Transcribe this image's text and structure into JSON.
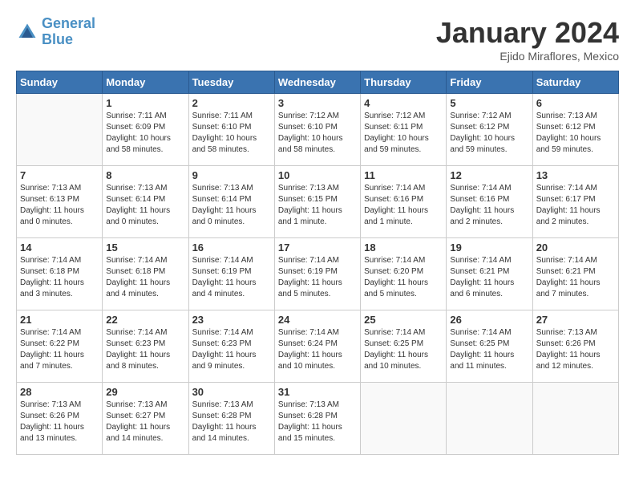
{
  "header": {
    "logo_general": "General",
    "logo_blue": "Blue",
    "month": "January 2024",
    "location": "Ejido Miraflores, Mexico"
  },
  "weekdays": [
    "Sunday",
    "Monday",
    "Tuesday",
    "Wednesday",
    "Thursday",
    "Friday",
    "Saturday"
  ],
  "weeks": [
    [
      {
        "day": "",
        "sunrise": "",
        "sunset": "",
        "daylight": ""
      },
      {
        "day": "1",
        "sunrise": "Sunrise: 7:11 AM",
        "sunset": "Sunset: 6:09 PM",
        "daylight": "Daylight: 10 hours and 58 minutes."
      },
      {
        "day": "2",
        "sunrise": "Sunrise: 7:11 AM",
        "sunset": "Sunset: 6:10 PM",
        "daylight": "Daylight: 10 hours and 58 minutes."
      },
      {
        "day": "3",
        "sunrise": "Sunrise: 7:12 AM",
        "sunset": "Sunset: 6:10 PM",
        "daylight": "Daylight: 10 hours and 58 minutes."
      },
      {
        "day": "4",
        "sunrise": "Sunrise: 7:12 AM",
        "sunset": "Sunset: 6:11 PM",
        "daylight": "Daylight: 10 hours and 59 minutes."
      },
      {
        "day": "5",
        "sunrise": "Sunrise: 7:12 AM",
        "sunset": "Sunset: 6:12 PM",
        "daylight": "Daylight: 10 hours and 59 minutes."
      },
      {
        "day": "6",
        "sunrise": "Sunrise: 7:13 AM",
        "sunset": "Sunset: 6:12 PM",
        "daylight": "Daylight: 10 hours and 59 minutes."
      }
    ],
    [
      {
        "day": "7",
        "sunrise": "Sunrise: 7:13 AM",
        "sunset": "Sunset: 6:13 PM",
        "daylight": "Daylight: 11 hours and 0 minutes."
      },
      {
        "day": "8",
        "sunrise": "Sunrise: 7:13 AM",
        "sunset": "Sunset: 6:14 PM",
        "daylight": "Daylight: 11 hours and 0 minutes."
      },
      {
        "day": "9",
        "sunrise": "Sunrise: 7:13 AM",
        "sunset": "Sunset: 6:14 PM",
        "daylight": "Daylight: 11 hours and 0 minutes."
      },
      {
        "day": "10",
        "sunrise": "Sunrise: 7:13 AM",
        "sunset": "Sunset: 6:15 PM",
        "daylight": "Daylight: 11 hours and 1 minute."
      },
      {
        "day": "11",
        "sunrise": "Sunrise: 7:14 AM",
        "sunset": "Sunset: 6:16 PM",
        "daylight": "Daylight: 11 hours and 1 minute."
      },
      {
        "day": "12",
        "sunrise": "Sunrise: 7:14 AM",
        "sunset": "Sunset: 6:16 PM",
        "daylight": "Daylight: 11 hours and 2 minutes."
      },
      {
        "day": "13",
        "sunrise": "Sunrise: 7:14 AM",
        "sunset": "Sunset: 6:17 PM",
        "daylight": "Daylight: 11 hours and 2 minutes."
      }
    ],
    [
      {
        "day": "14",
        "sunrise": "Sunrise: 7:14 AM",
        "sunset": "Sunset: 6:18 PM",
        "daylight": "Daylight: 11 hours and 3 minutes."
      },
      {
        "day": "15",
        "sunrise": "Sunrise: 7:14 AM",
        "sunset": "Sunset: 6:18 PM",
        "daylight": "Daylight: 11 hours and 4 minutes."
      },
      {
        "day": "16",
        "sunrise": "Sunrise: 7:14 AM",
        "sunset": "Sunset: 6:19 PM",
        "daylight": "Daylight: 11 hours and 4 minutes."
      },
      {
        "day": "17",
        "sunrise": "Sunrise: 7:14 AM",
        "sunset": "Sunset: 6:19 PM",
        "daylight": "Daylight: 11 hours and 5 minutes."
      },
      {
        "day": "18",
        "sunrise": "Sunrise: 7:14 AM",
        "sunset": "Sunset: 6:20 PM",
        "daylight": "Daylight: 11 hours and 5 minutes."
      },
      {
        "day": "19",
        "sunrise": "Sunrise: 7:14 AM",
        "sunset": "Sunset: 6:21 PM",
        "daylight": "Daylight: 11 hours and 6 minutes."
      },
      {
        "day": "20",
        "sunrise": "Sunrise: 7:14 AM",
        "sunset": "Sunset: 6:21 PM",
        "daylight": "Daylight: 11 hours and 7 minutes."
      }
    ],
    [
      {
        "day": "21",
        "sunrise": "Sunrise: 7:14 AM",
        "sunset": "Sunset: 6:22 PM",
        "daylight": "Daylight: 11 hours and 7 minutes."
      },
      {
        "day": "22",
        "sunrise": "Sunrise: 7:14 AM",
        "sunset": "Sunset: 6:23 PM",
        "daylight": "Daylight: 11 hours and 8 minutes."
      },
      {
        "day": "23",
        "sunrise": "Sunrise: 7:14 AM",
        "sunset": "Sunset: 6:23 PM",
        "daylight": "Daylight: 11 hours and 9 minutes."
      },
      {
        "day": "24",
        "sunrise": "Sunrise: 7:14 AM",
        "sunset": "Sunset: 6:24 PM",
        "daylight": "Daylight: 11 hours and 10 minutes."
      },
      {
        "day": "25",
        "sunrise": "Sunrise: 7:14 AM",
        "sunset": "Sunset: 6:25 PM",
        "daylight": "Daylight: 11 hours and 10 minutes."
      },
      {
        "day": "26",
        "sunrise": "Sunrise: 7:14 AM",
        "sunset": "Sunset: 6:25 PM",
        "daylight": "Daylight: 11 hours and 11 minutes."
      },
      {
        "day": "27",
        "sunrise": "Sunrise: 7:13 AM",
        "sunset": "Sunset: 6:26 PM",
        "daylight": "Daylight: 11 hours and 12 minutes."
      }
    ],
    [
      {
        "day": "28",
        "sunrise": "Sunrise: 7:13 AM",
        "sunset": "Sunset: 6:26 PM",
        "daylight": "Daylight: 11 hours and 13 minutes."
      },
      {
        "day": "29",
        "sunrise": "Sunrise: 7:13 AM",
        "sunset": "Sunset: 6:27 PM",
        "daylight": "Daylight: 11 hours and 14 minutes."
      },
      {
        "day": "30",
        "sunrise": "Sunrise: 7:13 AM",
        "sunset": "Sunset: 6:28 PM",
        "daylight": "Daylight: 11 hours and 14 minutes."
      },
      {
        "day": "31",
        "sunrise": "Sunrise: 7:13 AM",
        "sunset": "Sunset: 6:28 PM",
        "daylight": "Daylight: 11 hours and 15 minutes."
      },
      {
        "day": "",
        "sunrise": "",
        "sunset": "",
        "daylight": ""
      },
      {
        "day": "",
        "sunrise": "",
        "sunset": "",
        "daylight": ""
      },
      {
        "day": "",
        "sunrise": "",
        "sunset": "",
        "daylight": ""
      }
    ]
  ]
}
